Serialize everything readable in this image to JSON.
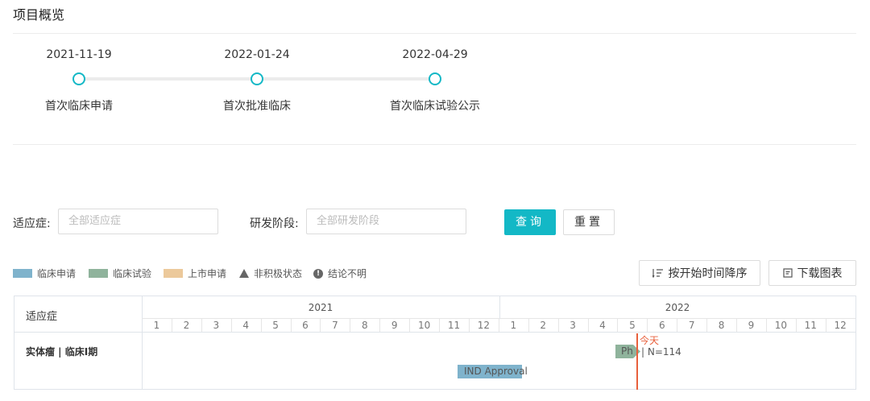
{
  "header": {
    "title": "项目概览"
  },
  "timeline": [
    {
      "date": "2021-11-19",
      "label": "首次临床申请"
    },
    {
      "date": "2022-01-24",
      "label": "首次批准临床"
    },
    {
      "date": "2022-04-29",
      "label": "首次临床试验公示"
    }
  ],
  "filters": {
    "indication_label": "适应症:",
    "indication_placeholder": "全部适应症",
    "stage_label": "研发阶段:",
    "stage_placeholder": "全部研发阶段",
    "query_button": "查询",
    "reset_button": "重置"
  },
  "legend": [
    {
      "label": "临床申请",
      "color": "#7fb3cc"
    },
    {
      "label": "临床试验",
      "color": "#8fb39c"
    },
    {
      "label": "上市申请",
      "color": "#ecc99b"
    },
    {
      "label": "非积极状态",
      "icon": "triangle-icon"
    },
    {
      "label": "结论不明",
      "icon": "exclamation-icon"
    }
  ],
  "toolbar": {
    "sort_button": "按开始时间降序",
    "download_button": "下载图表"
  },
  "gantt": {
    "column_header": "适应症",
    "years": [
      "2021",
      "2022"
    ],
    "months": [
      "1",
      "2",
      "3",
      "4",
      "5",
      "6",
      "7",
      "8",
      "9",
      "10",
      "11",
      "12"
    ],
    "rows": [
      {
        "label": "实体瘤 | 临床I期",
        "bars": [
          {
            "type": "临床申请",
            "text": "IND Approval"
          },
          {
            "type": "临床试验",
            "text": "Ph",
            "suffix": "| N=114"
          }
        ]
      }
    ],
    "today_label": "今天",
    "today_color": "#e8603c"
  }
}
